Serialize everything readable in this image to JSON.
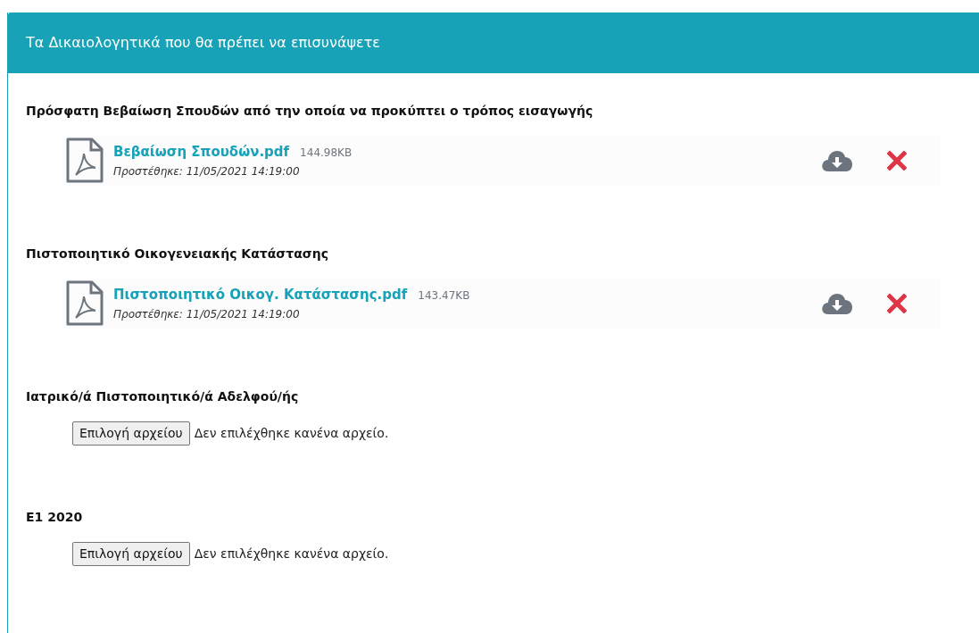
{
  "panel": {
    "title": "Τα Δικαιολογητικά που θα πρέπει να επισυνάψετε"
  },
  "documents": [
    {
      "kind": "file",
      "label": "Πρόσφατη Βεβαίωση Σπουδών από την οποία να προκύπτει ο τρόπος εισαγωγής",
      "file": {
        "name": "Βεβαίωση Σπουδών.pdf",
        "size": "144.98KB",
        "added": "Προστέθηκε: 11/05/2021 14:19:00"
      }
    },
    {
      "kind": "file",
      "label": "Πιστοποιητικό Οικογενειακής Κατάστασης",
      "file": {
        "name": "Πιστοποιητικό Οικογ. Κατάστασης.pdf",
        "size": "143.47KB",
        "added": "Προστέθηκε: 11/05/2021 14:19:00"
      }
    },
    {
      "kind": "empty",
      "label": "Ιατρικό/ά Πιστοποιητικό/ά Αδελφού/ής",
      "button": "Επιλογή αρχείου",
      "status": "Δεν επιλέχθηκε κανένα αρχείο."
    },
    {
      "kind": "empty",
      "label": "Ε1 2020",
      "button": "Επιλογή αρχείου",
      "status": "Δεν επιλέχθηκε κανένα αρχείο."
    }
  ]
}
